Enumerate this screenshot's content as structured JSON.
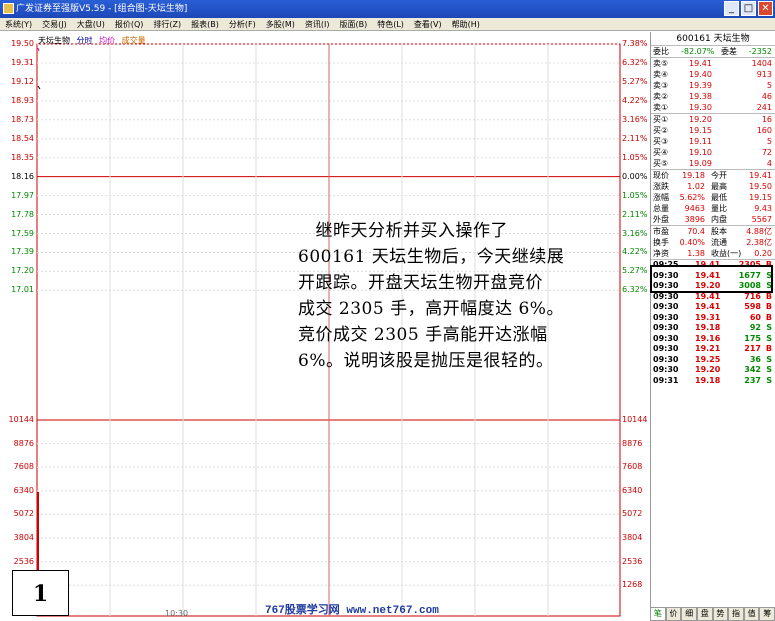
{
  "window": {
    "title": "广发证券至强版V5.59 - [组合图-天坛生物]"
  },
  "menu": [
    "系统(Y)",
    "交易(J)",
    "大盘(U)",
    "报价(Q)",
    "排行(Z)",
    "报表(B)",
    "分析(F)",
    "多股(M)",
    "资讯(I)",
    "版面(B)",
    "特色(L)",
    "查看(V)",
    "帮助(H)"
  ],
  "chart": {
    "stock_name": "天坛生物",
    "tab_intraday": "分时",
    "tab_avg": "均价",
    "tab_volume": "成交量",
    "price_axis_left": [
      "19.50",
      "19.31",
      "19.12",
      "18.93",
      "18.73",
      "18.54",
      "18.35",
      "18.16",
      "17.97",
      "17.78",
      "17.59",
      "17.39",
      "17.20",
      "17.01"
    ],
    "price_axis_right": [
      "7.38%",
      "6.32%",
      "5.27%",
      "4.22%",
      "3.16%",
      "2.11%",
      "1.05%",
      "0.00%",
      "1.05%",
      "2.11%",
      "3.16%",
      "4.22%",
      "5.27%",
      "6.32%"
    ],
    "volume_axis_left": [
      "10144",
      "8876",
      "7608",
      "6340",
      "5072",
      "3804",
      "2536"
    ],
    "volume_axis_right": [
      "10144",
      "8876",
      "7608",
      "6340",
      "5072",
      "3804",
      "2536",
      "1268"
    ],
    "time_label": "10:30"
  },
  "panel": {
    "code_title": "600161 天坛生物",
    "wei_label": "委比",
    "wei_value": "-82.07%",
    "weicha_label": "委差",
    "weicha_value": "-2352",
    "sell": [
      {
        "label": "卖⑤",
        "price": "19.41",
        "vol": "1404"
      },
      {
        "label": "卖④",
        "price": "19.40",
        "vol": "913"
      },
      {
        "label": "卖③",
        "price": "19.39",
        "vol": "5"
      },
      {
        "label": "卖②",
        "price": "19.38",
        "vol": "46"
      },
      {
        "label": "卖①",
        "price": "19.30",
        "vol": "241"
      }
    ],
    "buy": [
      {
        "label": "买①",
        "price": "19.20",
        "vol": "16"
      },
      {
        "label": "买②",
        "price": "19.15",
        "vol": "160"
      },
      {
        "label": "买③",
        "price": "19.11",
        "vol": "5"
      },
      {
        "label": "买④",
        "price": "19.10",
        "vol": "72"
      },
      {
        "label": "买⑤",
        "price": "19.09",
        "vol": "4"
      }
    ],
    "stats": [
      {
        "l1": "现价",
        "v1": "19.18",
        "l2": "今开",
        "v2": "19.41"
      },
      {
        "l1": "涨跌",
        "v1": "1.02",
        "l2": "最高",
        "v2": "19.50"
      },
      {
        "l1": "涨幅",
        "v1": "5.62%",
        "l2": "最低",
        "v2": "19.15"
      },
      {
        "l1": "总量",
        "v1": "9463",
        "l2": "量比",
        "v2": "9.43"
      },
      {
        "l1": "外盘",
        "v1": "3896",
        "l2": "内盘",
        "v2": "5567"
      }
    ],
    "stats2": [
      {
        "l1": "市盈",
        "v1": "70.4",
        "l2": "股本",
        "v2": "4.88亿"
      },
      {
        "l1": "换手",
        "v1": "0.40%",
        "l2": "流通",
        "v2": "2.38亿"
      },
      {
        "l1": "净资",
        "v1": "1.38",
        "l2": "收益(一)",
        "v2": "0.20"
      }
    ],
    "ticks": [
      {
        "time": "09:25",
        "price": "19.41",
        "vol": "2305",
        "dir": "B"
      },
      {
        "time": "09:30",
        "price": "19.41",
        "vol": "1677",
        "dir": "S"
      },
      {
        "time": "09:30",
        "price": "19.20",
        "vol": "3008",
        "dir": "S"
      },
      {
        "time": "09:30",
        "price": "19.41",
        "vol": "716",
        "dir": "B"
      },
      {
        "time": "09:30",
        "price": "19.41",
        "vol": "598",
        "dir": "B"
      },
      {
        "time": "09:30",
        "price": "19.31",
        "vol": "60",
        "dir": "B"
      },
      {
        "time": "09:30",
        "price": "19.18",
        "vol": "92",
        "dir": "S"
      },
      {
        "time": "09:30",
        "price": "19.16",
        "vol": "175",
        "dir": "S"
      },
      {
        "time": "09:30",
        "price": "19.21",
        "vol": "217",
        "dir": "B"
      },
      {
        "time": "09:30",
        "price": "19.25",
        "vol": "36",
        "dir": "S"
      },
      {
        "time": "09:30",
        "price": "19.20",
        "vol": "342",
        "dir": "S"
      },
      {
        "time": "09:31",
        "price": "19.18",
        "vol": "237",
        "dir": "S"
      }
    ],
    "bottom_tabs": [
      "笔",
      "价",
      "细",
      "盘",
      "势",
      "指",
      "值",
      "筹"
    ]
  },
  "annotation": {
    "lines": [
      "　继昨天分析并买入操作了",
      "600161 天坛生物后，今天继续展",
      "开跟踪。开盘天坛生物开盘竞价",
      "成交 2305 手，高开幅度达 6%。",
      "竞价成交 2305 手高能开达涨幅",
      "6%。说明该股是抛压是很轻的。"
    ]
  },
  "figure_number": "1",
  "watermark": "767股票学习网 www.net767.com"
}
